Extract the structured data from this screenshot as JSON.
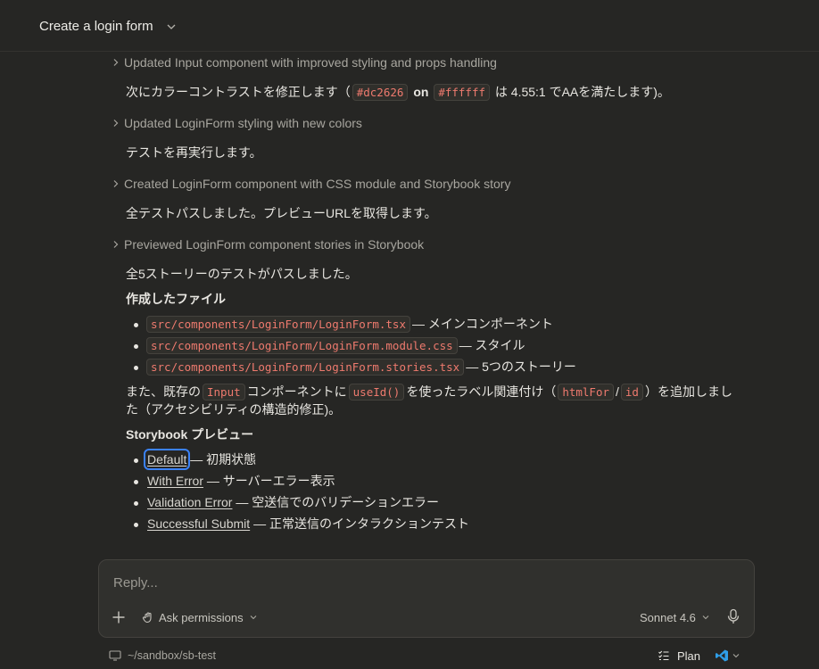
{
  "header": {
    "title": "Create a login form"
  },
  "tool_rows": [
    "Updated Input component with improved styling and props handling",
    "Updated LoginForm styling with new colors",
    "Created LoginForm component with CSS module and Storybook story",
    "Previewed LoginForm component stories in Storybook"
  ],
  "messages": {
    "contrast": {
      "pre": "次にカラーコントラストを修正します（",
      "code1": "#dc2626",
      "on": "on",
      "code2": "#ffffff",
      "post": "は 4.55:1 でAAを満たします)。"
    },
    "rerun": "テストを再実行します。",
    "allpass": "全テストパスしました。プレビューURLを取得します。",
    "stories_pass": "全5ストーリーのテストがパスしました。",
    "files_heading": "作成したファイル",
    "files": [
      {
        "path": "src/components/LoginForm/LoginForm.tsx",
        "desc": "— メインコンポーネント"
      },
      {
        "path": "src/components/LoginForm/LoginForm.module.css",
        "desc": "— スタイル"
      },
      {
        "path": "src/components/LoginForm/LoginForm.stories.tsx",
        "desc": "— 5つのストーリー"
      }
    ],
    "also": {
      "pre": "また、既存の",
      "code1": "Input",
      "mid1": "コンポーネントに",
      "code2": "useId()",
      "mid2": "を使ったラベル関連付け（",
      "code3": "htmlFor",
      "slash": "/",
      "code4": "id",
      "post": "）を追加しまし",
      "line2": "た（アクセシビリティの構造的修正)。"
    },
    "preview_heading": "Storybook プレビュー",
    "stories": [
      {
        "link": "Default",
        "desc": "— 初期状態"
      },
      {
        "link": "With Error",
        "desc": "— サーバーエラー表示"
      },
      {
        "link": "Validation Error",
        "desc": "— 空送信でのバリデーションエラー"
      },
      {
        "link": "Successful Submit",
        "desc": "— 正常送信のインタラクションテスト"
      }
    ]
  },
  "composer": {
    "placeholder": "Reply...",
    "permissions": "Ask permissions",
    "model": "Sonnet 4.6"
  },
  "footer": {
    "path": "~/sandbox/sb-test",
    "plan": "Plan"
  },
  "colors": {
    "background": "#262624",
    "code_text": "#ee7a6e",
    "focus": "#3b82f6"
  }
}
